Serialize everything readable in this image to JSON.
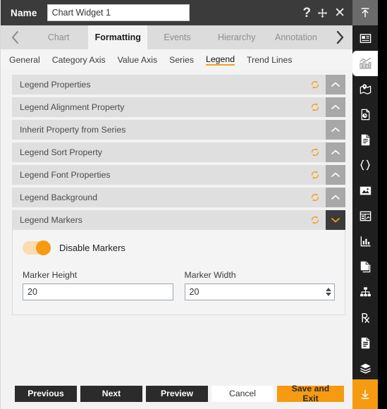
{
  "titlebar": {
    "name_label": "Name",
    "name_value": "Chart Widget 1",
    "name_placeholder": "Chart Widget 1",
    "help_icon": "question-mark-icon",
    "move_icon": "move-icon",
    "close_icon": "close-icon"
  },
  "tabstrip": {
    "prev_arrow": "chevron-left-icon",
    "next_arrow": "chevron-right-icon",
    "tabs": [
      {
        "label": "Chart",
        "active": false
      },
      {
        "label": "Formatting",
        "active": true
      },
      {
        "label": "Events",
        "active": false
      },
      {
        "label": "Hierarchy",
        "active": false
      },
      {
        "label": "Annotation",
        "active": false
      }
    ]
  },
  "subtabs": [
    {
      "label": "General",
      "active": false
    },
    {
      "label": "Category Axis",
      "active": false
    },
    {
      "label": "Value Axis",
      "active": false
    },
    {
      "label": "Series",
      "active": false
    },
    {
      "label": "Legend",
      "active": true
    },
    {
      "label": "Trend Lines",
      "active": false
    }
  ],
  "accordion": [
    {
      "label": "Legend Properties",
      "has_reset": true,
      "open": false
    },
    {
      "label": "Legend Alignment Property",
      "has_reset": true,
      "open": false
    },
    {
      "label": "Inherit Property from Series",
      "has_reset": false,
      "open": false
    },
    {
      "label": "Legend Sort Property",
      "has_reset": true,
      "open": false
    },
    {
      "label": "Legend Font Properties",
      "has_reset": true,
      "open": false
    },
    {
      "label": "Legend Background",
      "has_reset": true,
      "open": false
    },
    {
      "label": "Legend Markers",
      "has_reset": true,
      "open": true
    }
  ],
  "legend_markers_panel": {
    "toggle_label": "Disable Markers",
    "toggle_on": true,
    "marker_height": {
      "label": "Marker Height",
      "value": "20",
      "placeholder": "20"
    },
    "marker_width": {
      "label": "Marker Width",
      "value": "20",
      "placeholder": "20"
    }
  },
  "footer": {
    "previous": "Previous",
    "next": "Next",
    "preview": "Preview",
    "cancel": "Cancel",
    "save_and_exit": "Save and Exit"
  },
  "rail": {
    "top_icon": "collapse-up-icon",
    "items": [
      {
        "icon": "widget-panel-icon",
        "selected": false
      },
      {
        "icon": "chart-icon",
        "selected": true
      },
      {
        "icon": "map-pin-icon",
        "selected": false
      },
      {
        "icon": "document-clock-icon",
        "selected": false
      },
      {
        "icon": "document-text-icon",
        "selected": false
      },
      {
        "icon": "code-braces-icon",
        "selected": false
      },
      {
        "icon": "image-icon",
        "selected": false
      },
      {
        "icon": "grid-widget-icon",
        "selected": false
      },
      {
        "icon": "bar-chart-icon",
        "selected": false
      },
      {
        "icon": "copy-page-icon",
        "selected": false
      },
      {
        "icon": "hierarchy-icon",
        "selected": false
      },
      {
        "icon": "prescription-rx-icon",
        "selected": false
      },
      {
        "icon": "report-document-icon",
        "selected": false
      },
      {
        "icon": "layers-icon",
        "selected": false
      },
      {
        "icon": "qr-code-icon",
        "selected": false
      }
    ],
    "bottom_icon": "download-icon"
  },
  "colors": {
    "accent": "#f59a11",
    "titlebar_bg": "#3b3b3b",
    "rail_bg": "#1f1f1f",
    "panel_bg": "#f2f2f2",
    "accordion_bg": "#dfdfdf"
  }
}
